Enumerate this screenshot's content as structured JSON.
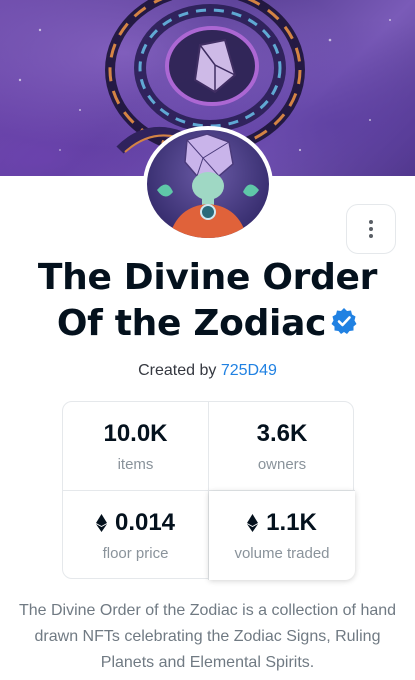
{
  "collection": {
    "title": "The Divine Order Of the Zodiac",
    "title_line1": "The Divine Order",
    "title_line2": "Of the Zodiac",
    "created_by_prefix": "Created by",
    "creator": "725D49",
    "description": "The Divine Order of the Zodiac is a collection of hand drawn NFTs celebrating the Zodiac Signs, Ruling Planets and Elemental Spirits."
  },
  "stats": {
    "items": {
      "value": "10.0K",
      "label": "items"
    },
    "owners": {
      "value": "3.6K",
      "label": "owners"
    },
    "floor": {
      "value": "0.014",
      "label": "floor price",
      "icon": "ethereum-icon"
    },
    "volume": {
      "value": "1.1K",
      "label": "volume traded",
      "icon": "ethereum-icon"
    }
  },
  "icons": {
    "verified": "verified-badge-icon",
    "more": "more-vertical-icon"
  },
  "colors": {
    "link": "#2081e2",
    "verified": "#2081e2",
    "text": "#04111d",
    "muted": "#8a939b"
  }
}
